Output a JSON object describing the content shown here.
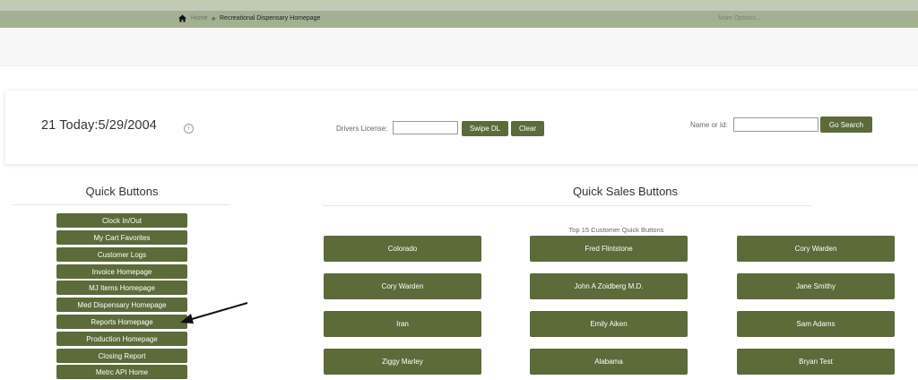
{
  "breadcrumb": {
    "home_label": "Home",
    "separator": "»",
    "current": "Recreational Dispensary Homepage",
    "more_options": "More Options..."
  },
  "header": {
    "today": "21 Today:5/29/2004",
    "info_icon": "info-icon",
    "drivers_license_label": "Drivers License:",
    "drivers_license_value": "",
    "swipe_button": "Swipe DL",
    "clear_button": "Clear",
    "name_id_label": "Name or Id:",
    "name_id_value": "",
    "search_button": "Go Search"
  },
  "quick_buttons": {
    "title": "Quick Buttons",
    "items": [
      "Clock In/Out",
      "My Cart Favorites",
      "Customer Logs",
      "Invoice Homepage",
      "MJ Items Homepage",
      "Med Dispensary Homepage",
      "Reports Homepage",
      "Production Homepage",
      "Closing Report",
      "Metrc API Home"
    ]
  },
  "quick_sales": {
    "title": "Quick Sales Buttons",
    "subtitle": "Top 15 Customer Quick Buttons",
    "buttons": [
      "Colorado",
      "Fred Flintstone",
      "Cory Warden",
      "Cory Warden",
      "John A Zoidberg M.D.",
      "Jane Smithy",
      "Iran",
      "Emily Aiken",
      "Sam Adams",
      "Ziggy Marley",
      "Alabama",
      "Bryan Test"
    ]
  },
  "colors": {
    "button": "#5b6b39",
    "breadcrumb_bar": "#a4b091",
    "top_strip": "#c3c9b4"
  }
}
